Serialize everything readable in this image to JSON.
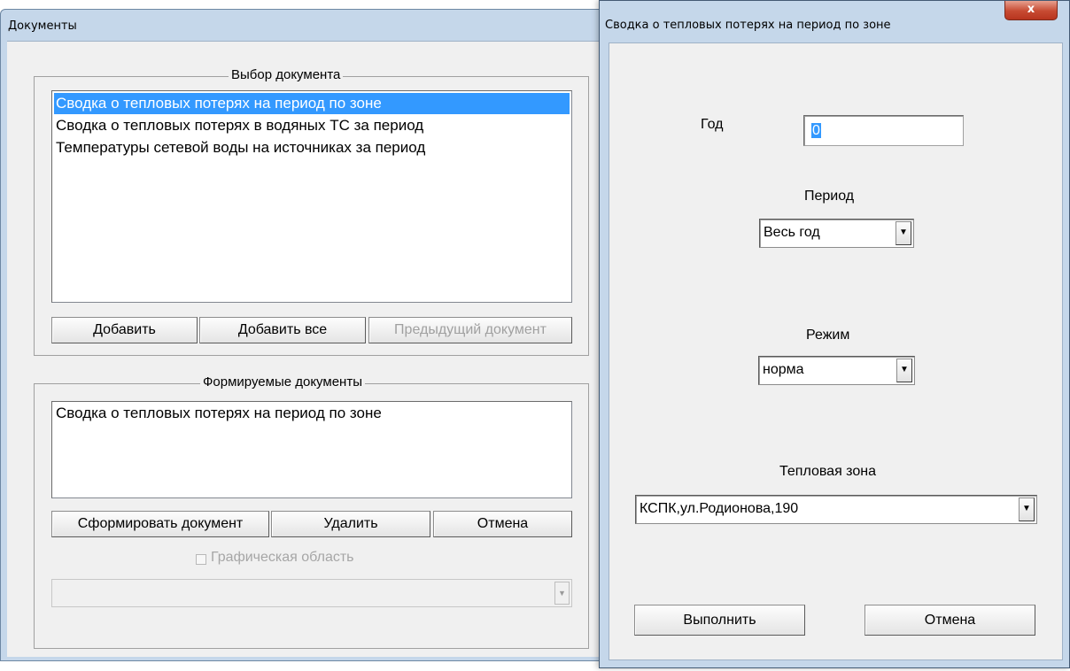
{
  "documents_window": {
    "title": "Документы",
    "select_group": {
      "caption": "Выбор документа",
      "items": [
        "Сводка о тепловых потерях на период по зоне",
        "Сводка о тепловых потерях в водяных ТС за период",
        "Температуры сетевой воды на источниках за период"
      ],
      "selected_index": 0,
      "buttons": {
        "add": "Добавить",
        "add_all": "Добавить все",
        "previous": "Предыдущий документ"
      }
    },
    "formed_group": {
      "caption": "Формируемые документы",
      "items": [
        "Сводка о тепловых потерях на период по зоне"
      ],
      "buttons": {
        "form": "Сформировать документ",
        "delete": "Удалить",
        "cancel": "Отмена"
      },
      "graphic_area_checkbox": "Графическая область",
      "graphic_area_checked": false
    }
  },
  "dialog": {
    "title": "Сводка о тепловых потерях на период по зоне",
    "close_glyph": "x",
    "year_label": "Год",
    "year_value": "0",
    "period_label": "Период",
    "period_value": "Весь год",
    "mode_label": "Режим",
    "mode_value": "норма",
    "zone_label": "Тепловая зона",
    "zone_value": "КСПК,ул.Родионова,190",
    "execute_button": "Выполнить",
    "cancel_button": "Отмена",
    "dropdown_glyph": "▼"
  },
  "colors": {
    "window_frame": "#c5d7ea",
    "client_bg": "#f0f0f0",
    "selection": "#3399ff",
    "close_button": "#c74a32"
  }
}
